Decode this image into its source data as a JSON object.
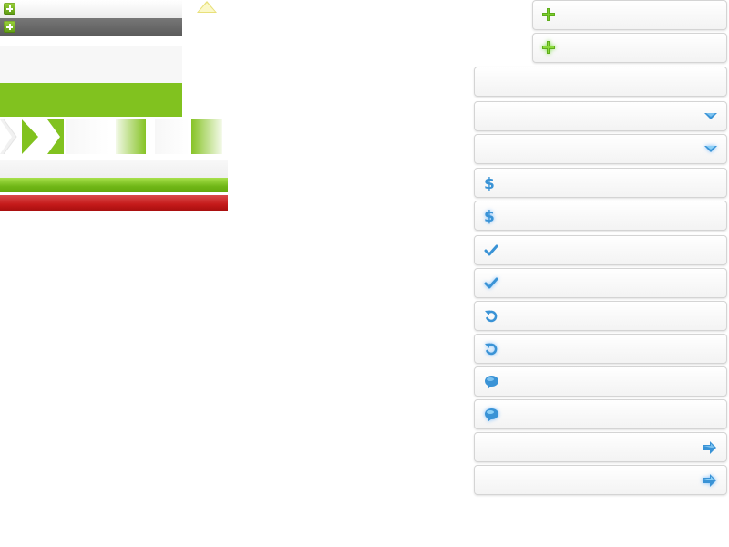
{
  "colors": {
    "accent_green": "#81c21f",
    "progress_green": "#6fb616",
    "error_red": "#c41a1a",
    "icon_blue": "#3a93d6",
    "dark_row": "#5a5a5a"
  },
  "left_sprites": {
    "rows": [
      {
        "icon": "plus-icon",
        "theme": "light"
      },
      {
        "icon": "plus-icon",
        "theme": "dark"
      }
    ],
    "tooltip_arrow": "triangle-up-icon",
    "chevrons": [
      "chevron-right-white",
      "chevron-right-green",
      "chevron-right-green"
    ],
    "bars": [
      "neutral",
      "success",
      "error"
    ]
  },
  "buttons": [
    {
      "icon": "plus-icon",
      "state": "normal"
    },
    {
      "icon": "plus-icon",
      "state": "hover"
    },
    {
      "icon": "none",
      "state": "normal"
    },
    {
      "icon": "dropdown-arrow-icon",
      "state": "normal"
    },
    {
      "icon": "dropdown-arrow-icon",
      "state": "hover"
    },
    {
      "icon": "dollar-icon",
      "state": "normal"
    },
    {
      "icon": "dollar-icon",
      "state": "hover"
    },
    {
      "icon": "checkmark-icon",
      "state": "normal"
    },
    {
      "icon": "checkmark-icon",
      "state": "hover"
    },
    {
      "icon": "refresh-icon",
      "state": "normal"
    },
    {
      "icon": "refresh-icon",
      "state": "hover"
    },
    {
      "icon": "speech-bubble-icon",
      "state": "normal"
    },
    {
      "icon": "speech-bubble-icon",
      "state": "hover"
    },
    {
      "icon": "arrow-right-icon",
      "state": "normal"
    },
    {
      "icon": "arrow-right-icon",
      "state": "hover"
    }
  ]
}
